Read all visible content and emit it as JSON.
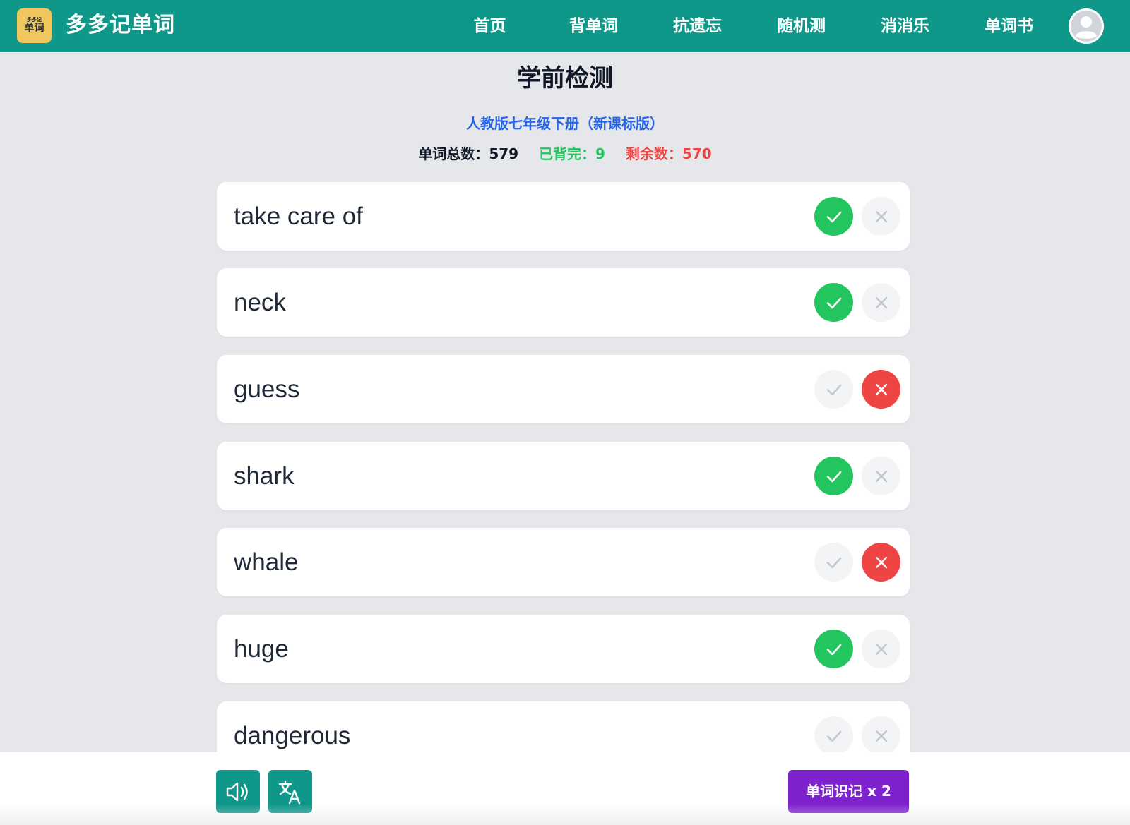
{
  "header": {
    "logo_small": "多多记",
    "logo_main": "单词",
    "brand": "多多记单词",
    "nav": [
      "首页",
      "背单词",
      "抗遗忘",
      "随机测",
      "消消乐",
      "单词书"
    ],
    "avatar_icon": "user-avatar-icon"
  },
  "page": {
    "title": "学前检测",
    "book_name": "人教版七年级下册（新课标版）",
    "stats": {
      "total_label": "单词总数：",
      "total_value": "579",
      "done_label": "已背完：",
      "done_value": "9",
      "left_label": "剩余数：",
      "left_value": "570"
    }
  },
  "words": [
    {
      "text": "take care of",
      "status": "known"
    },
    {
      "text": "neck",
      "status": "known"
    },
    {
      "text": "guess",
      "status": "unknown"
    },
    {
      "text": "shark",
      "status": "known"
    },
    {
      "text": "whale",
      "status": "unknown"
    },
    {
      "text": "huge",
      "status": "known"
    },
    {
      "text": "dangerous",
      "status": "none"
    }
  ],
  "toolbar": {
    "audio_icon": "speaker-icon",
    "translate_icon": "translate-icon",
    "memorize_label": "单词识记 x 2"
  },
  "colors": {
    "header": "#0f978a",
    "known": "#22c55e",
    "unknown": "#ef4444",
    "accent_purple": "#7e22ce",
    "book_blue": "#2563eb"
  }
}
